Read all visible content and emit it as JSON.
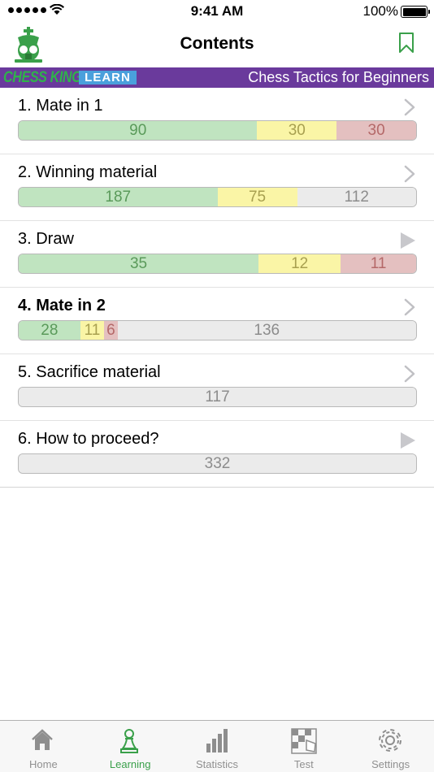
{
  "status": {
    "time": "9:41 AM",
    "battery": "100%"
  },
  "nav": {
    "title": "Contents",
    "logo_icon": "chess-king-logo-icon",
    "right_icon": "bookmark-icon"
  },
  "banner": {
    "brand": "CHESS KING",
    "learn": "LEARN",
    "course": "Chess Tactics for Beginners"
  },
  "colors": {
    "accent": "#3aa04a",
    "banner_bg": "#6a3a9c",
    "learn_badge": "#4aa0dc",
    "solved": "#c0e4c0",
    "partial": "#faf5a6",
    "failed": "#e4c0c0",
    "unsolved": "#ebebeb"
  },
  "items": [
    {
      "label": "1. Mate in 1",
      "bold": false,
      "action": "chevron",
      "solved": 90,
      "partial": 30,
      "failed": 30,
      "remaining": null
    },
    {
      "label": "2. Winning material",
      "bold": false,
      "action": "chevron",
      "solved": 187,
      "partial": 75,
      "failed": null,
      "remaining": 112
    },
    {
      "label": "3. Draw",
      "bold": false,
      "action": "play",
      "solved": 35,
      "partial": 12,
      "failed": 11,
      "remaining": null
    },
    {
      "label": "4. Mate in 2",
      "bold": true,
      "action": "chevron",
      "solved": 28,
      "partial": 11,
      "failed": 6,
      "remaining": 136
    },
    {
      "label": "5. Sacrifice material",
      "bold": false,
      "action": "chevron",
      "solved": null,
      "partial": null,
      "failed": null,
      "remaining": 117
    },
    {
      "label": "6. How to proceed?",
      "bold": false,
      "action": "play",
      "solved": null,
      "partial": null,
      "failed": null,
      "remaining": 332
    }
  ],
  "tabs": [
    {
      "label": "Home",
      "icon": "home-icon",
      "active": false
    },
    {
      "label": "Learning",
      "icon": "pawn-icon",
      "active": true
    },
    {
      "label": "Statistics",
      "icon": "bar-chart-icon",
      "active": false
    },
    {
      "label": "Test",
      "icon": "chessboard-hand-icon",
      "active": false
    },
    {
      "label": "Settings",
      "icon": "gear-icon",
      "active": false
    }
  ]
}
